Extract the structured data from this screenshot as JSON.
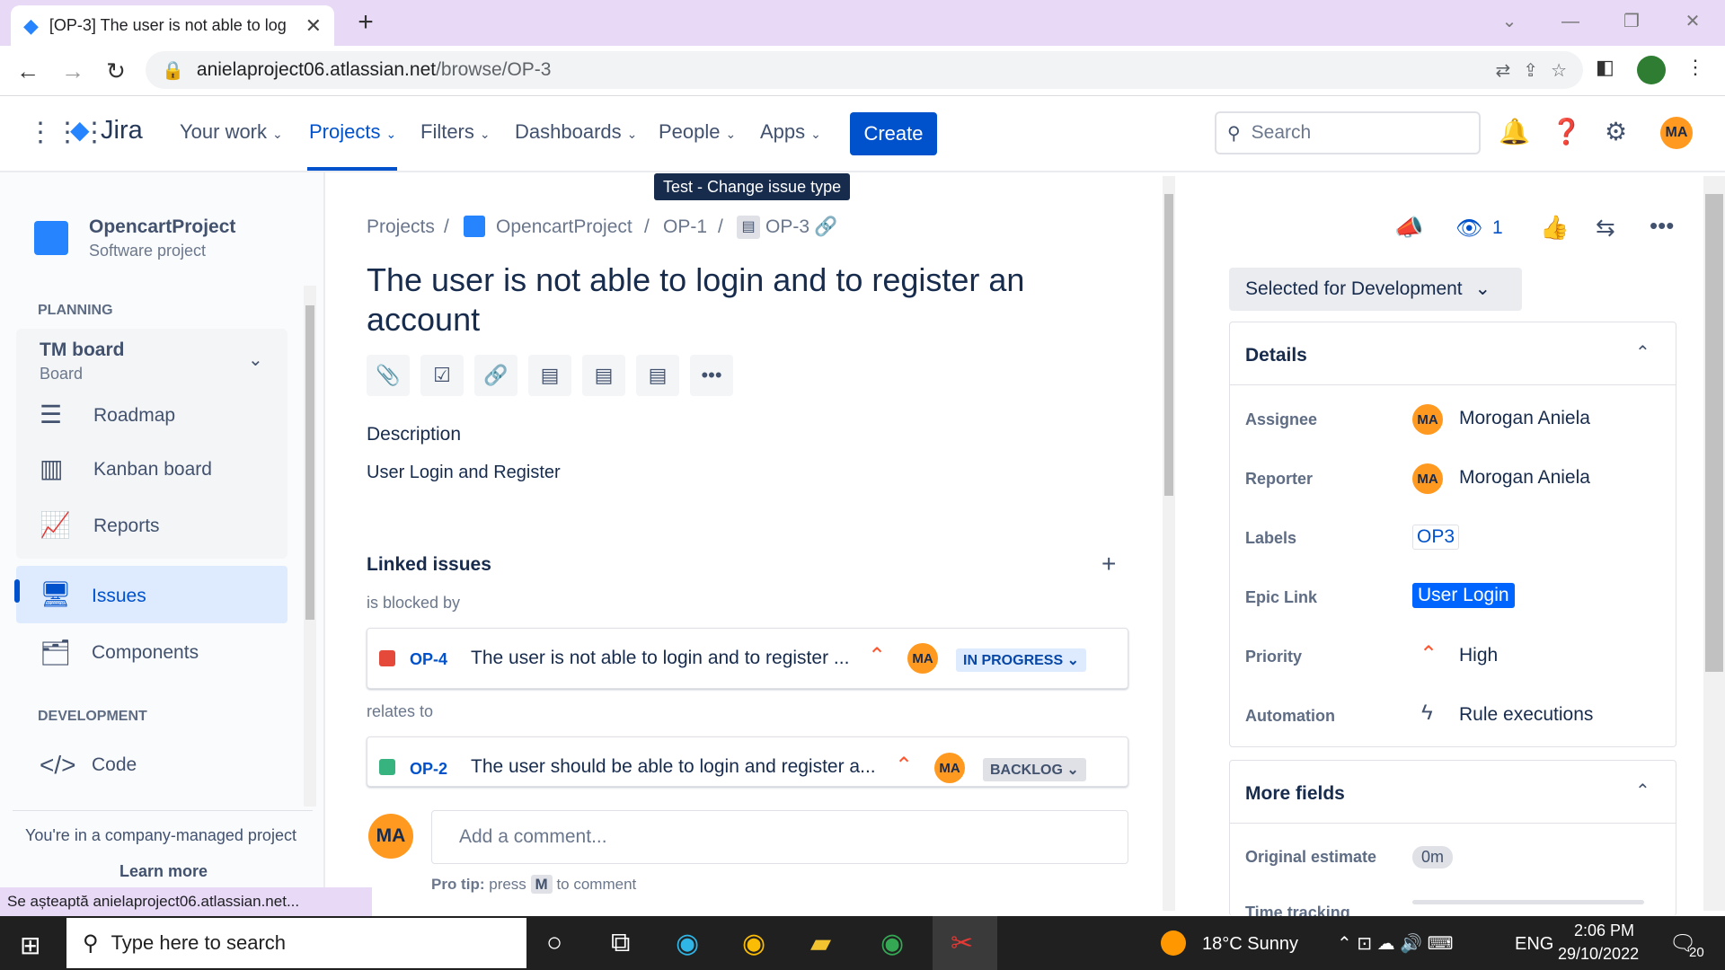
{
  "browser": {
    "tab_title": "[OP-3] The user is not able to log",
    "url_host": "anielaproject06.atlassian.net",
    "url_path": "/browse/OP-3",
    "loading_status": "Se așteaptă anielaproject06.atlassian.net..."
  },
  "jira_nav": {
    "logo": "Jira",
    "items": [
      "Your work",
      "Projects",
      "Filters",
      "Dashboards",
      "People",
      "Apps"
    ],
    "create": "Create",
    "search_placeholder": "Search",
    "avatar": "MA"
  },
  "tooltip": "Test - Change issue type",
  "sidebar": {
    "project_name": "OpencartProject",
    "project_type": "Software project",
    "planning_heading": "PLANNING",
    "board_name": "TM board",
    "board_sub": "Board",
    "items": [
      "Roadmap",
      "Kanban board",
      "Reports",
      "Issues",
      "Components"
    ],
    "development_heading": "DEVELOPMENT",
    "dev_items": [
      "Code"
    ],
    "footer_text": "You're in a company-managed project",
    "learn_more": "Learn more"
  },
  "issue": {
    "breadcrumb": [
      "Projects",
      "OpencartProject",
      "OP-1",
      "OP-3"
    ],
    "title": "The user is not able to login and to register an account",
    "description_heading": "Description",
    "description": "User Login and Register",
    "linked_heading": "Linked issues",
    "groups": [
      {
        "relation": "is blocked by",
        "key": "OP-4",
        "summary": "The user is not able to login and to register ...",
        "assignee": "MA",
        "status": "IN PROGRESS"
      },
      {
        "relation": "relates to",
        "key": "OP-2",
        "summary": "The user should be able to login and register a...",
        "assignee": "MA",
        "status": "BACKLOG"
      }
    ],
    "comment_avatar": "MA",
    "comment_placeholder": "Add a comment...",
    "pro_tip_prefix": "Pro tip:",
    "pro_tip_press": "press",
    "pro_tip_key": "M",
    "pro_tip_suffix": "to comment"
  },
  "right_panel": {
    "watchers": "1",
    "status": "Selected for Development",
    "details_heading": "Details",
    "fields": {
      "assignee_label": "Assignee",
      "assignee": "Morogan Aniela",
      "assignee_avatar": "MA",
      "reporter_label": "Reporter",
      "reporter": "Morogan Aniela",
      "reporter_avatar": "MA",
      "labels_label": "Labels",
      "labels": "OP3",
      "epic_label": "Epic Link",
      "epic": "User Login",
      "priority_label": "Priority",
      "priority": "High",
      "automation_label": "Automation",
      "automation": "Rule executions"
    },
    "more_fields_heading": "More fields",
    "original_estimate_label": "Original estimate",
    "original_estimate": "0m",
    "time_tracking_label": "Time tracking"
  },
  "taskbar": {
    "search_placeholder": "Type here to search",
    "weather": "18°C  Sunny",
    "lang": "ENG",
    "time": "2:06 PM",
    "date": "29/10/2022",
    "notifications": "20"
  },
  "colors": {
    "accent": "#0052cc",
    "tab_bar": "#e8d9f7",
    "avatar": "#ff991f",
    "priority_high": "#ff5630",
    "in_progress_bg": "#deebff",
    "backlog_bg": "#dfe1e6",
    "epic_bg": "#0065ff"
  }
}
